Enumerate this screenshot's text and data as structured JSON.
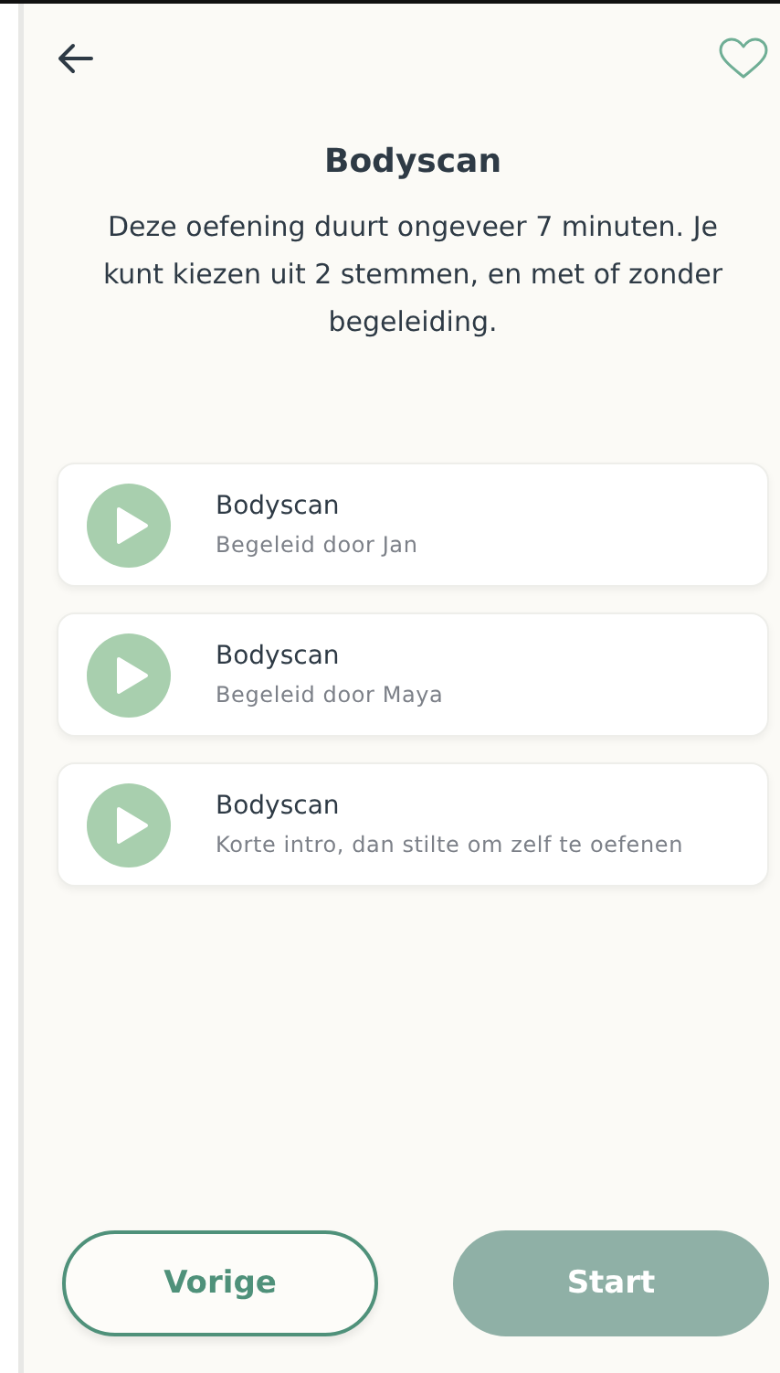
{
  "header": {
    "title": "Bodyscan",
    "description": "Deze oefening duurt ongeveer 7 minuten. Je kunt kiezen uit 2 stemmen, en met of zonder begeleiding."
  },
  "options": [
    {
      "title": "Bodyscan",
      "subtitle": "Begeleid door Jan"
    },
    {
      "title": "Bodyscan",
      "subtitle": "Begeleid door Maya"
    },
    {
      "title": "Bodyscan",
      "subtitle": "Korte intro, dan stilte om zelf te oefenen"
    }
  ],
  "buttons": [
    {
      "label": "Vorige",
      "kind": "outline",
      "disabled": false
    },
    {
      "label": "Start",
      "kind": "filled",
      "disabled": true
    }
  ]
}
